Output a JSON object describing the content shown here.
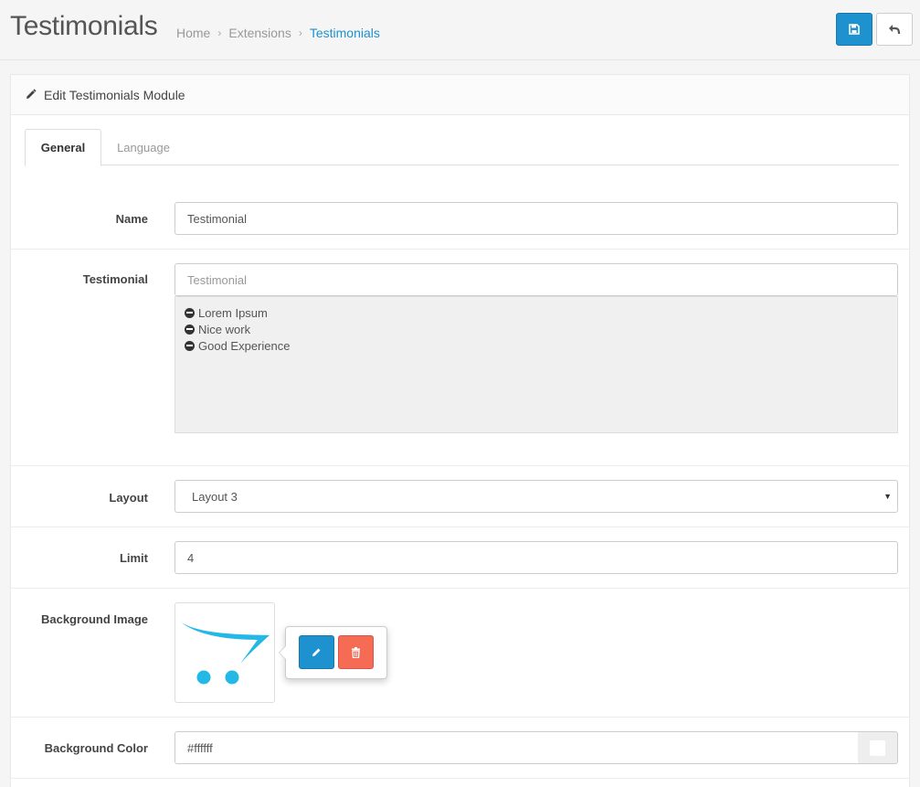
{
  "header": {
    "title": "Testimonials",
    "breadcrumbs": [
      {
        "label": "Home"
      },
      {
        "label": "Extensions"
      },
      {
        "label": "Testimonials"
      }
    ]
  },
  "panel": {
    "heading": "Edit Testimonials Module"
  },
  "tabs": [
    {
      "label": "General",
      "active": true
    },
    {
      "label": "Language",
      "active": false
    }
  ],
  "form": {
    "name": {
      "label": "Name",
      "value": "Testimonial"
    },
    "testimonial": {
      "label": "Testimonial",
      "placeholder": "Testimonial",
      "items": [
        "Lorem Ipsum",
        "Nice work",
        "Good Experience"
      ]
    },
    "layout": {
      "label": "Layout",
      "value": "Layout 3"
    },
    "limit": {
      "label": "Limit",
      "value": "4"
    },
    "background_image": {
      "label": "Background Image"
    },
    "background_color": {
      "label": "Background Color",
      "value": "#ffffff",
      "swatch": "#ffffff"
    }
  },
  "colors": {
    "primary": "#1e91cf",
    "danger": "#f56b54",
    "logo": "#23b8e6"
  }
}
